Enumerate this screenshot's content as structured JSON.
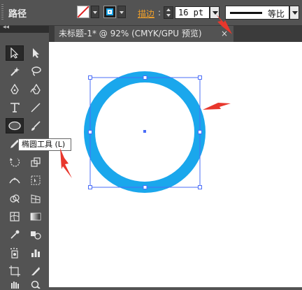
{
  "control_bar": {
    "selection_type": "路径",
    "stroke_label": "描边",
    "colon": ":",
    "stroke_weight": "16 pt",
    "profile_label": "等比"
  },
  "document": {
    "tab_title": "未标题-1* @ 92% (CMYK/GPU 预览)",
    "close": "×"
  },
  "tooltip": {
    "text": "椭圆工具 (L)"
  },
  "colors": {
    "circle_stroke": "#1aa7ec",
    "selection": "#4a6cf7",
    "annotation_arrow": "#e8372c",
    "ui_dark": "#535353"
  },
  "tools": [
    "selection-tool",
    "direct-selection-tool",
    "magic-wand-tool",
    "lasso-tool",
    "pen-tool",
    "curvature-tool",
    "type-tool",
    "line-segment-tool",
    "ellipse-tool",
    "paintbrush-tool",
    "pencil-tool",
    "eraser-tool",
    "rotate-tool",
    "scale-tool",
    "width-tool",
    "free-transform-tool",
    "shape-builder-tool",
    "perspective-grid-tool",
    "mesh-tool",
    "gradient-tool",
    "eyedropper-tool",
    "blend-tool",
    "symbol-sprayer-tool",
    "column-graph-tool",
    "artboard-tool",
    "slice-tool",
    "hand-tool",
    "zoom-tool"
  ]
}
